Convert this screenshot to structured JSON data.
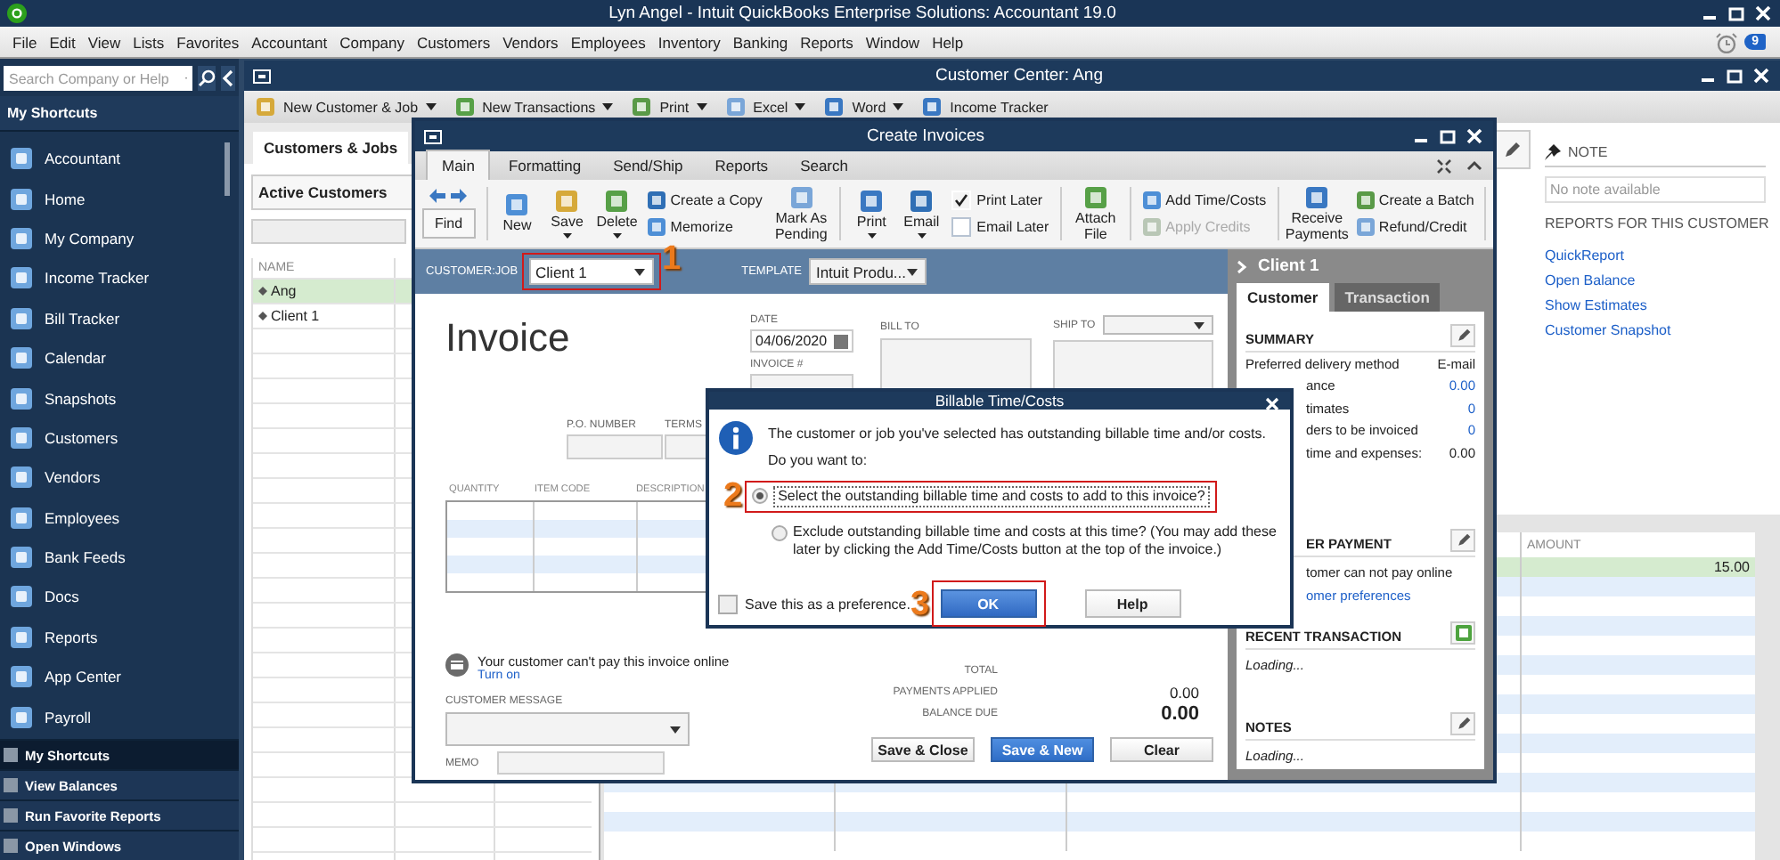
{
  "window": {
    "title": "Lyn Angel  - Intuit QuickBooks Enterprise Solutions: Accountant 19.0"
  },
  "menu": [
    "File",
    "Edit",
    "View",
    "Lists",
    "Favorites",
    "Accountant",
    "Company",
    "Customers",
    "Vendors",
    "Employees",
    "Inventory",
    "Banking",
    "Reports",
    "Window",
    "Help"
  ],
  "reminder_badge": "9",
  "sidebar": {
    "search": {
      "placeholder": "Search Company or Help"
    },
    "header": "My Shortcuts",
    "items": [
      "Accountant",
      "Home",
      "My Company",
      "Income Tracker",
      "Bill Tracker",
      "Calendar",
      "Snapshots",
      "Customers",
      "Vendors",
      "Employees",
      "Bank Feeds",
      "Docs",
      "Reports",
      "App Center",
      "Payroll"
    ],
    "sections": [
      {
        "label": "My Shortcuts",
        "selected": true
      },
      {
        "label": "View Balances",
        "selected": false
      },
      {
        "label": "Run Favorite Reports",
        "selected": false
      },
      {
        "label": "Open Windows",
        "selected": false
      }
    ]
  },
  "customer_center": {
    "title": "Customer Center: Ang",
    "toolbar": [
      {
        "label": "New Customer & Job",
        "dropdown": true
      },
      {
        "label": "New Transactions",
        "dropdown": true
      },
      {
        "label": "Print",
        "dropdown": true
      },
      {
        "label": "Excel",
        "dropdown": true
      },
      {
        "label": "Word",
        "dropdown": true
      },
      {
        "label": "Income Tracker",
        "dropdown": false
      }
    ],
    "tabs": [
      {
        "label": "Customers & Jobs",
        "selected": true
      }
    ],
    "filter": "Active Customers",
    "list": {
      "columns": [
        "NAME"
      ],
      "rows": [
        {
          "name": "Ang",
          "selected": true
        },
        {
          "name": "Client 1",
          "selected": false
        }
      ]
    },
    "note": {
      "heading": "NOTE",
      "placeholder": "No note available"
    },
    "reports": {
      "heading": "REPORTS FOR THIS CUSTOMER",
      "links": [
        "QuickReport",
        "Open Balance",
        "Show Estimates",
        "Customer Snapshot"
      ]
    },
    "transactions": {
      "columns": [
        "AMOUNT"
      ],
      "rows": [
        {
          "amount": "15.00",
          "selected": true
        }
      ]
    }
  },
  "invoice_window": {
    "title": "Create Invoices",
    "tabs": [
      {
        "label": "Main",
        "selected": true
      },
      {
        "label": "Formatting",
        "selected": false
      },
      {
        "label": "Send/Ship",
        "selected": false
      },
      {
        "label": "Reports",
        "selected": false
      },
      {
        "label": "Search",
        "selected": false
      }
    ],
    "toolbar": [
      {
        "kind": "find",
        "label": "Find"
      },
      {
        "kind": "divider"
      },
      {
        "kind": "big",
        "label": "New",
        "dropdown": false
      },
      {
        "kind": "big",
        "label": "Save",
        "dropdown": true
      },
      {
        "kind": "big",
        "label": "Delete",
        "dropdown": true
      },
      {
        "kind": "stack",
        "items": [
          {
            "label": "Create a Copy",
            "disabled": false
          },
          {
            "label": "Memorize",
            "disabled": false
          }
        ]
      },
      {
        "kind": "big",
        "label": "Mark As Pending",
        "dropdown": false
      },
      {
        "kind": "divider"
      },
      {
        "kind": "big",
        "label": "Print",
        "dropdown": true
      },
      {
        "kind": "big",
        "label": "Email",
        "dropdown": true
      },
      {
        "kind": "checks",
        "items": [
          {
            "label": "Print Later",
            "checked": true
          },
          {
            "label": "Email Later",
            "checked": false
          }
        ]
      },
      {
        "kind": "divider"
      },
      {
        "kind": "big",
        "label": "Attach File",
        "dropdown": false
      },
      {
        "kind": "divider"
      },
      {
        "kind": "stack",
        "items": [
          {
            "label": "Add Time/Costs",
            "disabled": false
          },
          {
            "label": "Apply Credits",
            "disabled": true
          }
        ]
      },
      {
        "kind": "divider"
      },
      {
        "kind": "big",
        "label": "Receive Payments",
        "dropdown": false
      },
      {
        "kind": "stack",
        "items": [
          {
            "label": "Create a Batch",
            "disabled": false
          },
          {
            "label": "Refund/Credit",
            "disabled": false
          }
        ]
      },
      {
        "kind": "divider"
      }
    ],
    "customer_label": "CUSTOMER:JOB",
    "customer": "Client 1",
    "template_label": "TEMPLATE",
    "template": "Intuit Produ...",
    "form": {
      "title": "Invoice",
      "date_label": "DATE",
      "date": "04/06/2020",
      "invoice_no_label": "INVOICE #",
      "bill_to": "BILL TO",
      "ship_to": "SHIP TO",
      "po_label": "P.O. NUMBER",
      "terms_label": "TERMS",
      "columns": [
        "QUANTITY",
        "ITEM CODE",
        "DESCRIPTION"
      ],
      "online_notice": "Your customer can't pay this invoice online",
      "turn_on": "Turn on",
      "message_label": "CUSTOMER MESSAGE",
      "memo_label": "MEMO",
      "total_label": "TOTAL",
      "payments_applied": {
        "label": "PAYMENTS APPLIED",
        "value": "0.00"
      },
      "balance_due": {
        "label": "BALANCE DUE",
        "value": "0.00"
      },
      "buttons": [
        {
          "label": "Save & Close",
          "primary": false
        },
        {
          "label": "Save & New",
          "primary": true
        },
        {
          "label": "Clear",
          "primary": false
        }
      ]
    },
    "side_panel": {
      "name": "Client 1",
      "tabs": [
        {
          "label": "Customer",
          "selected": true
        },
        {
          "label": "Transaction",
          "selected": false
        }
      ],
      "summary_heading": "SUMMARY",
      "summary": [
        {
          "kind": "full",
          "label": "Preferred delivery method",
          "value": "E-mail",
          "link": false
        },
        {
          "kind": "cut",
          "label": "ance",
          "value": "0.00",
          "link": true
        },
        {
          "kind": "cut",
          "label": "timates",
          "value": "0",
          "link": true
        },
        {
          "kind": "cut",
          "label": "ders to be invoiced",
          "value": "0",
          "link": true
        },
        {
          "kind": "cut",
          "label": "time and expenses:",
          "value": "0.00",
          "link": false
        }
      ],
      "payment_heading": "ER PAYMENT",
      "payment_text": "tomer can not pay online",
      "payment_link": "omer preferences",
      "recent_heading": "RECENT TRANSACTION",
      "recent_text": "Loading...",
      "notes_heading": "NOTES",
      "notes_text": "Loading..."
    }
  },
  "dialog": {
    "title": "Billable Time/Costs",
    "message": "The customer or job you've selected has outstanding billable time and/or costs.",
    "question": "Do you want to:",
    "options": [
      {
        "label": "Select the outstanding billable time and costs to add to this invoice?",
        "selected": true
      },
      {
        "label": "Exclude outstanding billable time and costs at this time? (You may add these later by clicking the Add Time/Costs button at the top of the invoice.)",
        "selected": false
      }
    ],
    "preference": {
      "label": "Save this as a preference.",
      "checked": false
    },
    "buttons": [
      {
        "label": "OK",
        "primary": true
      },
      {
        "label": "Help",
        "primary": false
      }
    ]
  },
  "annotations": [
    {
      "label": "1"
    },
    {
      "label": "2"
    },
    {
      "label": "3"
    }
  ]
}
